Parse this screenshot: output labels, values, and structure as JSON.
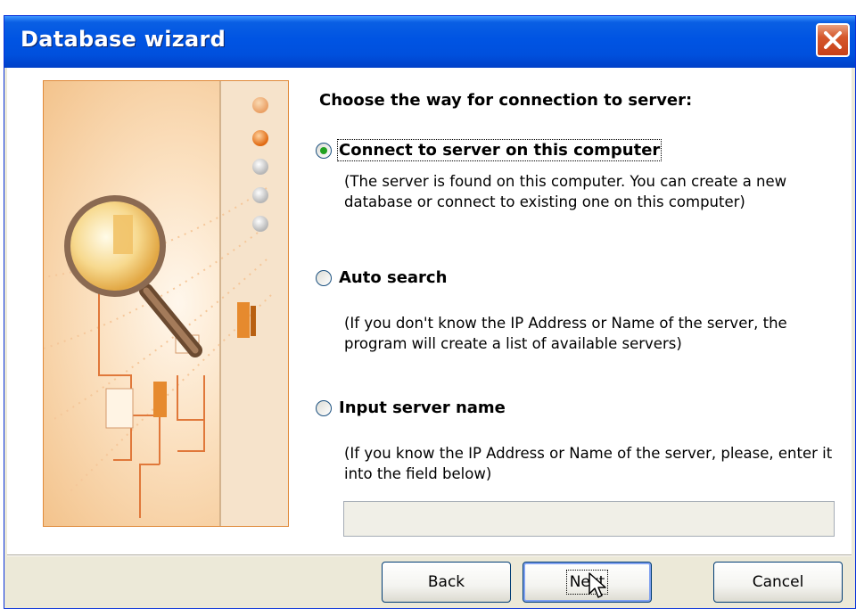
{
  "window": {
    "title": "Database wizard",
    "close_icon": "close-icon"
  },
  "steps": {
    "total": 5,
    "current": 2
  },
  "main": {
    "heading": "Choose the way for connection to server:",
    "options": [
      {
        "label": "Connect to server on this computer",
        "description": "(The server is found on this computer. You can create a new database or connect to existing one on this computer)",
        "selected": true
      },
      {
        "label": "Auto search",
        "description": "(If you don't know the IP Address or Name of the server, the program will create a list of available servers)",
        "selected": false
      },
      {
        "label": "Input server name",
        "description": "(If you know the IP Address or Name of the server, please, enter it into the field below)",
        "selected": false
      }
    ],
    "server_name_value": ""
  },
  "buttons": {
    "back": "Back",
    "next": "Next",
    "cancel": "Cancel"
  },
  "colors": {
    "titlebar": "#0054e3",
    "accent": "#f08a24",
    "radio_check": "#21a121"
  }
}
